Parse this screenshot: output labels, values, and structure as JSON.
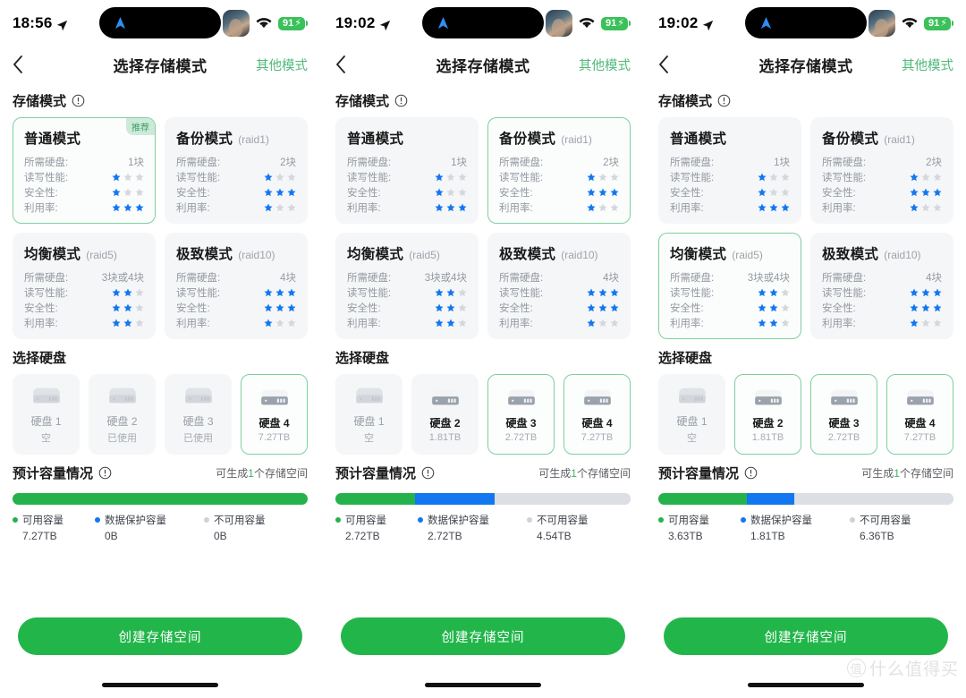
{
  "watermark": {
    "badge": "值",
    "text": "什么值得买"
  },
  "labels": {
    "nav_title": "选择存储模式",
    "nav_action": "其他模式",
    "section_modes": "存储模式",
    "section_disks": "选择硬盘",
    "section_capacity": "预计容量情况",
    "capacity_note_prefix": "可生成",
    "capacity_note_count": "1",
    "capacity_note_suffix": "个存储空间",
    "cta": "创建存储空间",
    "row_disks_needed": "所需硬盘:",
    "row_rw": "读写性能:",
    "row_safety": "安全性:",
    "row_usage": "利用率:",
    "recommend_badge": "推荐",
    "legend_avail": "可用容量",
    "legend_protect": "数据保护容量",
    "legend_unusable": "不可用容量"
  },
  "colors": {
    "accent_green": "#22b64a",
    "select_border": "#7fcfa0",
    "star_on": "#1277f0",
    "star_off": "#d4d7dc",
    "bar_avail": "#25b24b",
    "bar_protect": "#1277f0",
    "bar_unusable": "#dcdfe3",
    "badge_bg": "#cdead8",
    "badge_text": "#3c9e67"
  },
  "modes": [
    {
      "name": "普通模式",
      "raid": "",
      "disks": "1块",
      "rw": 1,
      "safety": 1,
      "usage": 3
    },
    {
      "name": "备份模式",
      "raid": "(raid1)",
      "disks": "2块",
      "rw": 1,
      "safety": 3,
      "usage": 1
    },
    {
      "name": "均衡模式",
      "raid": "(raid5)",
      "disks": "3块或4块",
      "rw": 2,
      "safety": 2,
      "usage": 2
    },
    {
      "name": "极致模式",
      "raid": "(raid10)",
      "disks": "4块",
      "rw": 3,
      "safety": 3,
      "usage": 1
    }
  ],
  "panels": [
    {
      "status": {
        "time": "18:56",
        "battery": "91",
        "icons": [
          "location-arrow-icon",
          "wifi-icon",
          "battery-icon"
        ]
      },
      "selected_mode": 0,
      "show_recommend_on": 0,
      "disks": [
        {
          "name": "硬盘 1",
          "sub": "空",
          "selected": false,
          "empty": true
        },
        {
          "name": "硬盘 2",
          "sub": "已使用",
          "selected": false,
          "empty": true
        },
        {
          "name": "硬盘 3",
          "sub": "已使用",
          "selected": false,
          "empty": true
        },
        {
          "name": "硬盘 4",
          "sub": "7.27TB",
          "selected": true,
          "empty": false
        }
      ],
      "capacity": {
        "avail": "7.27TB",
        "protect": "0B",
        "unusable": "0B",
        "avail_pct": 100,
        "protect_pct": 0,
        "unusable_pct": 0,
        "spaces": "1"
      }
    },
    {
      "status": {
        "time": "19:02",
        "battery": "91",
        "icons": [
          "location-arrow-icon",
          "wifi-icon",
          "battery-icon"
        ]
      },
      "selected_mode": 1,
      "show_recommend_on": -1,
      "disks": [
        {
          "name": "硬盘 1",
          "sub": "空",
          "selected": false,
          "empty": true
        },
        {
          "name": "硬盘 2",
          "sub": "1.81TB",
          "selected": false,
          "empty": false
        },
        {
          "name": "硬盘 3",
          "sub": "2.72TB",
          "selected": true,
          "empty": false
        },
        {
          "name": "硬盘 4",
          "sub": "7.27TB",
          "selected": true,
          "empty": false
        }
      ],
      "capacity": {
        "avail": "2.72TB",
        "protect": "2.72TB",
        "unusable": "4.54TB",
        "avail_pct": 27,
        "protect_pct": 27,
        "unusable_pct": 46,
        "spaces": "1"
      }
    },
    {
      "status": {
        "time": "19:02",
        "battery": "91",
        "icons": [
          "location-arrow-icon",
          "wifi-icon",
          "battery-icon"
        ]
      },
      "selected_mode": 2,
      "show_recommend_on": -1,
      "disks": [
        {
          "name": "硬盘 1",
          "sub": "空",
          "selected": false,
          "empty": true
        },
        {
          "name": "硬盘 2",
          "sub": "1.81TB",
          "selected": true,
          "empty": false
        },
        {
          "name": "硬盘 3",
          "sub": "2.72TB",
          "selected": true,
          "empty": false
        },
        {
          "name": "硬盘 4",
          "sub": "7.27TB",
          "selected": true,
          "empty": false
        }
      ],
      "capacity": {
        "avail": "3.63TB",
        "protect": "1.81TB",
        "unusable": "6.36TB",
        "avail_pct": 30,
        "protect_pct": 16,
        "unusable_pct": 54,
        "spaces": "1"
      }
    }
  ]
}
